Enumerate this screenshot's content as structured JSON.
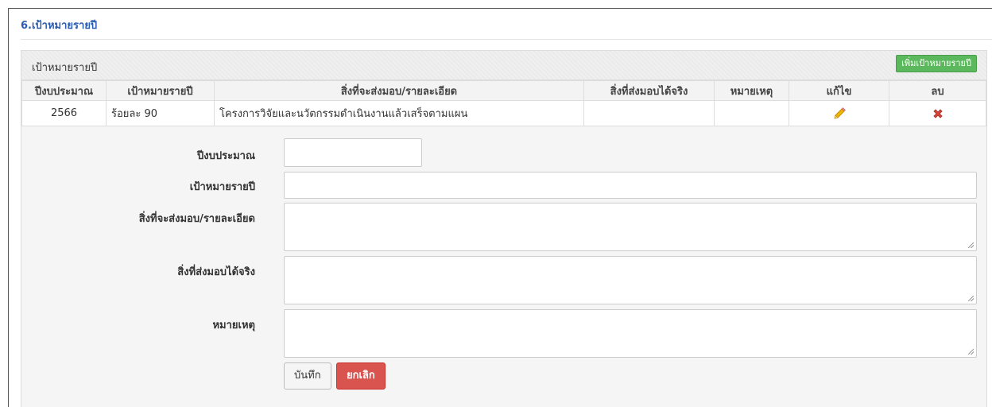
{
  "section": {
    "title": "6.เป้าหมายรายปี"
  },
  "panel": {
    "title": "เป้าหมายรายปี",
    "add_button": "เพิ่มเป้าหมายรายปี"
  },
  "table": {
    "headers": [
      "ปีงบประมาณ",
      "เป้าหมายรายปี",
      "สิ่งที่จะส่งมอบ/รายละเอียด",
      "สิ่งที่ส่งมอบได้จริง",
      "หมายเหตุ",
      "แก้ไข",
      "ลบ"
    ],
    "rows": [
      {
        "year": "2566",
        "target": "ร้อยละ 90",
        "deliverable": "โครงการวิจัยและนวัตกรรมดำเนินงานแล้วเสร็จตามแผน",
        "actual": "",
        "note": "",
        "edit_icon": "pencil-icon",
        "delete_icon": "red-x-icon"
      }
    ]
  },
  "form": {
    "year_label": "ปีงบประมาณ",
    "year_value": "",
    "target_label": "เป้าหมายรายปี",
    "target_value": "",
    "deliverable_label": "สิ่งที่จะส่งมอบ/รายละเอียด",
    "deliverable_value": "",
    "actual_label": "สิ่งที่ส่งมอบได้จริง",
    "actual_value": "",
    "note_label": "หมายเหตุ",
    "note_value": "",
    "save_button": "บันทึก",
    "cancel_button": "ยกเลิก"
  },
  "colors": {
    "title": "#2a5db0",
    "add_button": "#5cb85c",
    "cancel_button": "#d9534f",
    "delete_icon": "#d9443a",
    "edit_icon": "#e0a800"
  }
}
